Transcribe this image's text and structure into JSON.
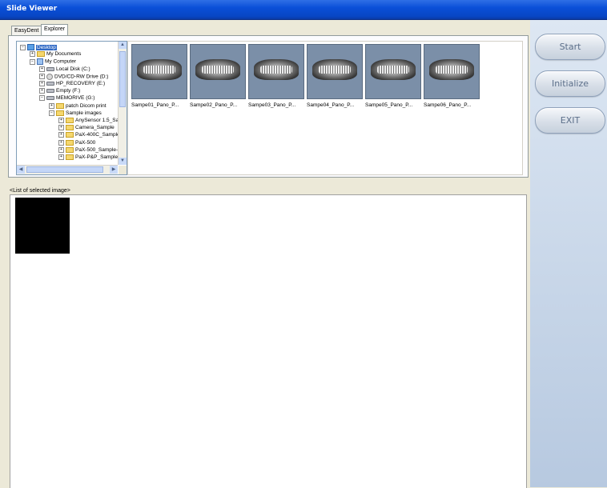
{
  "window": {
    "title": "Slide Viewer"
  },
  "tabs": [
    {
      "label": "EasyDent",
      "active": false
    },
    {
      "label": "Explorer",
      "active": true
    }
  ],
  "tree": {
    "nodes": [
      {
        "label": "Desktop",
        "icon": "desktop-icon",
        "expander": "−",
        "selected": true
      },
      {
        "label": "My Documents",
        "icon": "folder-icon",
        "expander": "+"
      },
      {
        "label": "My Computer",
        "icon": "computer-icon",
        "expander": "−"
      },
      {
        "label": "Local Disk (C:)",
        "icon": "drive-icon",
        "expander": "+"
      },
      {
        "label": "DVD/CD-RW Drive (D:)",
        "icon": "cd-drive-icon",
        "expander": "+"
      },
      {
        "label": "HP_RECOVERY (E:)",
        "icon": "drive-icon",
        "expander": "+"
      },
      {
        "label": "Empty (F:)",
        "icon": "drive-icon",
        "expander": "+"
      },
      {
        "label": "MEMORIVE (G:)",
        "icon": "drive-icon",
        "expander": "−"
      },
      {
        "label": "patch Dicom print",
        "icon": "folder-icon",
        "expander": "+"
      },
      {
        "label": "Sample images",
        "icon": "folder-icon",
        "expander": "−"
      },
      {
        "label": "AnySensor 1.5_Sa",
        "icon": "folder-icon",
        "expander": "+"
      },
      {
        "label": "Camera_Sample",
        "icon": "folder-icon",
        "expander": "+"
      },
      {
        "label": "PaX-400C_Sample",
        "icon": "folder-icon",
        "expander": "+"
      },
      {
        "label": "PaX-500",
        "icon": "folder-icon",
        "expander": "+"
      },
      {
        "label": "PaX-500_Sample-",
        "icon": "folder-icon",
        "expander": "+"
      },
      {
        "label": "PaX-P&P_Sample",
        "icon": "folder-icon",
        "expander": "+"
      }
    ]
  },
  "thumbnails": [
    {
      "label": "Sampe01_Pano_P..."
    },
    {
      "label": "Sampe02_Pano_P..."
    },
    {
      "label": "Sampe03_Pano_P..."
    },
    {
      "label": "Sampe04_Pano_P..."
    },
    {
      "label": "Sampe05_Pano_P..."
    },
    {
      "label": "Sampe06_Pano_P..."
    }
  ],
  "selected_list": {
    "label": "<List of selected image>"
  },
  "buttons": {
    "start": "Start",
    "initialize": "Initialize",
    "exit": "EXIT"
  },
  "colors": {
    "titlebar": "#0a4fd8",
    "selection": "#316ac5",
    "thumb_bg": "#7b8fa8",
    "right_panel": "#c8d6e8"
  }
}
